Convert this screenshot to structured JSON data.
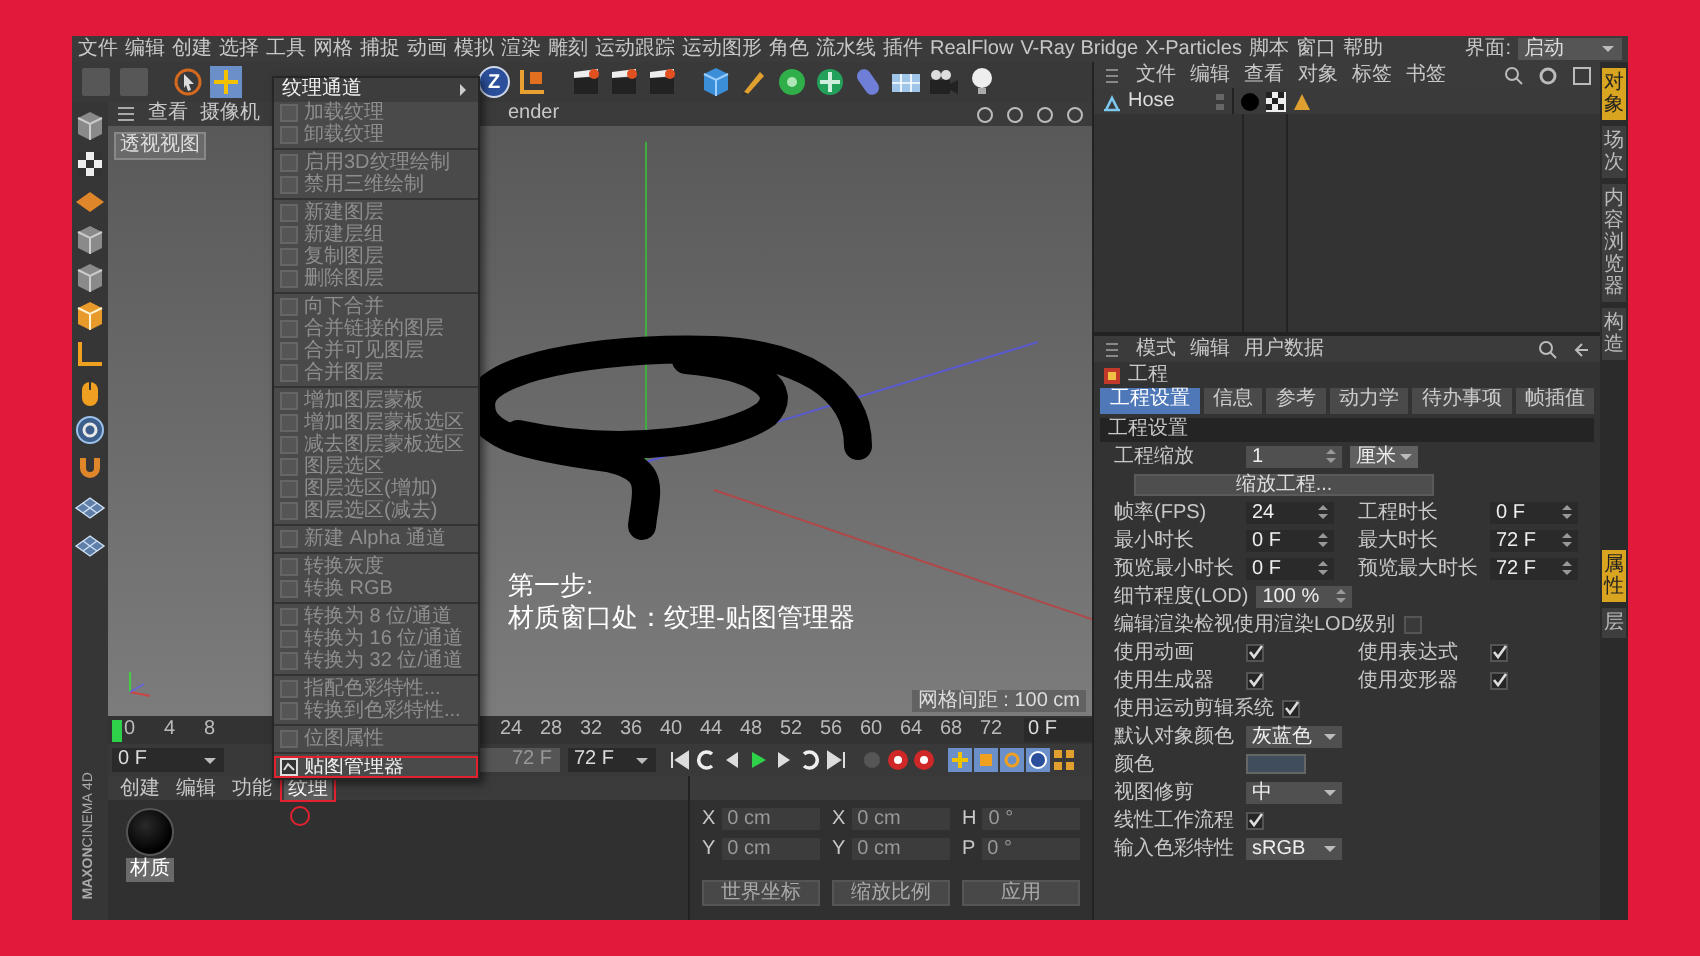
{
  "menu_bar": {
    "items": [
      "文件",
      "编辑",
      "创建",
      "选择",
      "工具",
      "网格",
      "捕捉",
      "动画",
      "模拟",
      "渲染",
      "雕刻",
      "运动跟踪",
      "运动图形",
      "角色",
      "流水线",
      "插件",
      "RealFlow",
      "V-Ray Bridge",
      "X-Particles",
      "脚本",
      "窗口",
      "帮助"
    ],
    "layout_label": "界面:",
    "layout_value": "启动"
  },
  "toolbar": {
    "axis_button": "Z"
  },
  "texture_menu": {
    "title": "纹理通道",
    "groups": [
      {
        "items": [
          {
            "label": "加载纹理",
            "disabled": true,
            "highlighted": false
          },
          {
            "label": "卸载纹理",
            "disabled": true,
            "highlighted": false
          }
        ]
      },
      {
        "items": [
          {
            "label": "启用3D纹理绘制",
            "disabled": true,
            "highlighted": false
          },
          {
            "label": "禁用三维绘制",
            "disabled": true,
            "highlighted": false
          }
        ]
      },
      {
        "items": [
          {
            "label": "新建图层",
            "disabled": true,
            "highlighted": false
          },
          {
            "label": "新建层组",
            "disabled": true,
            "highlighted": false
          },
          {
            "label": "复制图层",
            "disabled": true,
            "highlighted": false
          },
          {
            "label": "删除图层",
            "disabled": true,
            "highlighted": false
          }
        ]
      },
      {
        "items": [
          {
            "label": "向下合并",
            "disabled": true,
            "highlighted": false
          },
          {
            "label": "合并链接的图层",
            "disabled": true,
            "highlighted": false
          },
          {
            "label": "合并可见图层",
            "disabled": true,
            "highlighted": false
          },
          {
            "label": "合并图层",
            "disabled": true,
            "highlighted": false
          }
        ]
      },
      {
        "items": [
          {
            "label": "增加图层蒙板",
            "disabled": true,
            "highlighted": false
          },
          {
            "label": "增加图层蒙板选区",
            "disabled": true,
            "highlighted": false
          },
          {
            "label": "减去图层蒙板选区",
            "disabled": true,
            "highlighted": false
          },
          {
            "label": "图层选区",
            "disabled": true,
            "highlighted": false
          },
          {
            "label": "图层选区(增加)",
            "disabled": true,
            "highlighted": false
          },
          {
            "label": "图层选区(减去)",
            "disabled": true,
            "highlighted": false
          }
        ]
      },
      {
        "items": [
          {
            "label": "新建 Alpha 通道",
            "disabled": true,
            "highlighted": false
          }
        ]
      },
      {
        "items": [
          {
            "label": "转换灰度",
            "disabled": true,
            "highlighted": false
          },
          {
            "label": "转换 RGB",
            "disabled": true,
            "highlighted": false
          }
        ]
      },
      {
        "items": [
          {
            "label": "转换为 8 位/通道",
            "disabled": true,
            "highlighted": false
          },
          {
            "label": "转换为 16 位/通道",
            "disabled": true,
            "highlighted": false
          },
          {
            "label": "转换为 32 位/通道",
            "disabled": true,
            "highlighted": false
          }
        ]
      },
      {
        "items": [
          {
            "label": "指配色彩特性...",
            "disabled": true,
            "highlighted": false
          },
          {
            "label": "转换到色彩特性...",
            "disabled": true,
            "highlighted": false
          }
        ]
      },
      {
        "items": [
          {
            "label": "位图属性",
            "disabled": true,
            "highlighted": false
          }
        ]
      },
      {
        "items": [
          {
            "label": "贴图管理器",
            "disabled": false,
            "highlighted": true
          }
        ]
      }
    ]
  },
  "viewport": {
    "menu": [
      "查看",
      "摄像机"
    ],
    "renderer": "ender",
    "view_name": "透视视图",
    "caption": {
      "heading": "第一步:",
      "text": "材质窗口处：纹理-贴图管理器"
    },
    "grid_spacing": "网格间距 : 100 cm"
  },
  "timeline": {
    "ticks": [
      "0",
      "4",
      "8",
      "24",
      "28",
      "32",
      "36",
      "40",
      "44",
      "48",
      "52",
      "56",
      "60",
      "64",
      "68",
      "72"
    ],
    "current_frame": "0 F"
  },
  "transport": {
    "start": "0 F",
    "preview_end": "72 F",
    "end": "72 F"
  },
  "material_manager": {
    "tabs": [
      {
        "label": "创建",
        "selected": false,
        "highlighted": false
      },
      {
        "label": "编辑",
        "selected": false,
        "highlighted": false
      },
      {
        "label": "功能",
        "selected": false,
        "highlighted": false
      },
      {
        "label": "纹理",
        "selected": true,
        "highlighted": true
      }
    ],
    "materials": [
      {
        "name": "材质",
        "selected": true
      }
    ]
  },
  "coordinates": {
    "rows": [
      {
        "axis": "X",
        "position": "0 cm",
        "size_axis": "X",
        "size": "0 cm",
        "rotation_axis": "H",
        "rotation": "0 °"
      },
      {
        "axis": "Y",
        "position": "0 cm",
        "size_axis": "Y",
        "size": "0 cm",
        "rotation_axis": "P",
        "rotation": "0 °"
      }
    ],
    "buttons": [
      "世界坐标",
      "缩放比例",
      "应用"
    ]
  },
  "object_manager": {
    "menu": [
      "文件",
      "编辑",
      "查看",
      "对象",
      "标签",
      "书签"
    ],
    "objects": [
      {
        "name": "Hose"
      }
    ]
  },
  "attribute_manager": {
    "menu": [
      "模式",
      "编辑",
      "用户数据"
    ],
    "title": "工程",
    "tabs": [
      {
        "label": "工程设置",
        "selected": true
      },
      {
        "label": "信息",
        "selected": false
      },
      {
        "label": "参考",
        "selected": false
      },
      {
        "label": "动力学",
        "selected": false
      },
      {
        "label": "待办事项",
        "selected": false
      },
      {
        "label": "帧插值",
        "selected": false
      }
    ],
    "section": "工程设置",
    "rows": [
      {
        "kind": "field",
        "label": "工程缩放",
        "value": "1",
        "unit": "厘米"
      },
      {
        "kind": "button",
        "label": "缩放工程..."
      },
      {
        "kind": "pair",
        "items": [
          {
            "label": "帧率(FPS)",
            "value": "24"
          },
          {
            "label": "工程时长",
            "value": "0 F"
          }
        ]
      },
      {
        "kind": "pair",
        "items": [
          {
            "label": "最小时长",
            "value": "0 F"
          },
          {
            "label": "最大时长",
            "value": "72 F"
          }
        ]
      },
      {
        "kind": "pair",
        "items": [
          {
            "label": "预览最小时长",
            "value": "0 F"
          },
          {
            "label": "预览最大时长",
            "value": "72 F"
          }
        ]
      },
      {
        "kind": "field",
        "label": "细节程度(LOD)",
        "value": "100 %"
      },
      {
        "kind": "check",
        "label": "编辑渲染检视使用渲染LOD级别",
        "checked": false
      },
      {
        "kind": "check_pair",
        "items": [
          {
            "label": "使用动画",
            "checked": true
          },
          {
            "label": "使用表达式",
            "checked": true
          }
        ]
      },
      {
        "kind": "check_pair",
        "items": [
          {
            "label": "使用生成器",
            "checked": true
          },
          {
            "label": "使用变形器",
            "checked": true
          }
        ]
      },
      {
        "kind": "check",
        "label": "使用运动剪辑系统",
        "checked": true
      },
      {
        "kind": "select",
        "label": "默认对象颜色",
        "value": "灰蓝色"
      },
      {
        "kind": "color",
        "label": "颜色",
        "color": "#3f4d5c"
      },
      {
        "kind": "select",
        "label": "视图修剪",
        "value": "中"
      },
      {
        "kind": "check",
        "label": "线性工作流程",
        "checked": true
      },
      {
        "kind": "select",
        "label": "输入色彩特性",
        "value": "sRGB"
      }
    ]
  },
  "side_tabs": {
    "top": [
      {
        "label": "对象",
        "selected": true
      },
      {
        "label": "场次",
        "selected": false
      },
      {
        "label": "内容浏览器",
        "selected": false
      },
      {
        "label": "构造",
        "selected": false
      }
    ],
    "bottom": [
      {
        "label": "属性",
        "selected": true
      },
      {
        "label": "层",
        "selected": false
      }
    ]
  },
  "brand": [
    "MAXON",
    "CINEMA 4D"
  ]
}
